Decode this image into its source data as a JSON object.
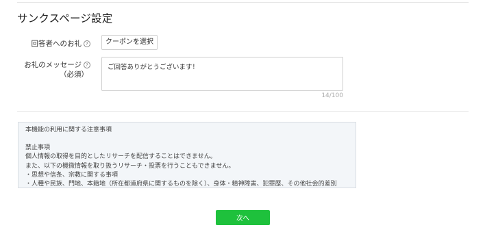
{
  "section": {
    "title": "サンクスページ設定"
  },
  "reward_row": {
    "label": "回答者へのお礼",
    "help_icon": "?",
    "coupon_button": "クーポンを選択"
  },
  "message_row": {
    "label_line1": "お礼のメッセージ",
    "label_line2": "（必須）",
    "help_icon": "?",
    "value": "ご回答ありがとうございます！",
    "counter": "14/100"
  },
  "notice": {
    "title": "本機能の利用に関する注意事項",
    "lines": [
      "禁止事項",
      "個人情報の取得を目的としたリサーチを配信することはできません。",
      "また、以下の機微情報を取り扱うリサーチ・投票を行うこともできません。",
      "・思想や信条、宗教に関する事項",
      "・人種や民族、門地、本籍地（所在都道府県に関するものを除く）、身体・精神障害、犯罪歴、その他社会的差別"
    ]
  },
  "footer": {
    "next_button": "次へ"
  },
  "colors": {
    "primary_green": "#1ec13c",
    "notice_bg": "#f3f6f9"
  }
}
